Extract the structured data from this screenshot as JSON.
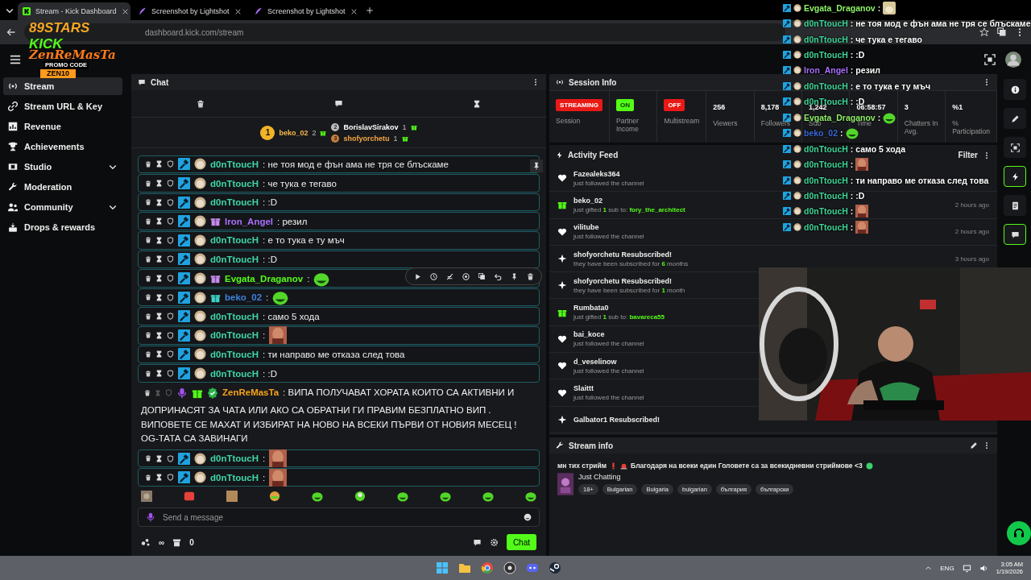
{
  "tabs": [
    {
      "title": "Stream - Kick Dashboard",
      "selected": true
    },
    {
      "title": "Screenshot by Lightshot",
      "selected": false
    },
    {
      "title": "Screenshot by Lightshot",
      "selected": false
    }
  ],
  "address_bar": {
    "url": "dashboard.kick.com/stream"
  },
  "overlay_logo": {
    "brand": "89STARS",
    "kick": "KICK",
    "streamer": "ZenReMasTa",
    "promo": "PROMO CODE",
    "code": "ZEN10"
  },
  "sidebar": {
    "items": [
      {
        "label": "Stream",
        "selected": true,
        "expandable": false
      },
      {
        "label": "Stream URL & Key",
        "selected": false,
        "expandable": false
      },
      {
        "label": "Revenue",
        "selected": false,
        "expandable": false
      },
      {
        "label": "Achievements",
        "selected": false,
        "expandable": false
      },
      {
        "label": "Studio",
        "selected": false,
        "expandable": true
      },
      {
        "label": "Moderation",
        "selected": false,
        "expandable": false
      },
      {
        "label": "Community",
        "selected": false,
        "expandable": true
      },
      {
        "label": "Drops & rewards",
        "selected": false,
        "expandable": false
      }
    ]
  },
  "chat": {
    "title": "Chat",
    "leaderboard": [
      {
        "rank": "1",
        "user": "beko_02",
        "count": "2",
        "color": "#f5b84a"
      },
      {
        "rank": "2",
        "user": "BorislavSirakov",
        "count": "1",
        "color": "#ffffff"
      },
      {
        "rank": "3",
        "user": "shofyorchetu",
        "count": "1",
        "color": "#f5a742"
      }
    ],
    "messages": [
      {
        "kind": "mod",
        "user": "d0nTtoucH",
        "color": "#3fd6a8",
        "text": ": не тоя мод е фън ама не тря се блъскаме",
        "hovered": false
      },
      {
        "kind": "mod",
        "user": "d0nTtoucH",
        "color": "#3fd6a8",
        "text": ": че тука е тегаво",
        "hovered": false
      },
      {
        "kind": "mod",
        "user": "d0nTtoucH",
        "color": "#3fd6a8",
        "text": ": :D",
        "hovered": false
      },
      {
        "kind": "mod",
        "user": "Iron_Angel",
        "color": "#a970ff",
        "gift": {
          "color": "#c88cf0"
        },
        "text": ": резил",
        "hovered": false
      },
      {
        "kind": "mod",
        "user": "d0nTtoucH",
        "color": "#3fd6a8",
        "text": ": е то тука е ту мъч",
        "hovered": false
      },
      {
        "kind": "mod",
        "user": "d0nTtoucH",
        "color": "#3fd6a8",
        "text": ": :D",
        "hovered": false
      },
      {
        "kind": "mod",
        "user": "Evgata_Draganov",
        "color": "#53fc18",
        "gift": {
          "color": "#c88cf0"
        },
        "text": ":",
        "emote": {
          "kind": "frog"
        },
        "hovered": true
      },
      {
        "kind": "mod",
        "user": "beko_02",
        "color": "#3b82e0",
        "gift": {
          "color": "#3fd6c8"
        },
        "text": ":",
        "emote": {
          "kind": "frog"
        },
        "hovered": false
      },
      {
        "kind": "mod",
        "user": "d0nTtoucH",
        "color": "#3fd6a8",
        "text": ": само 5 хода",
        "hovered": false
      },
      {
        "kind": "mod",
        "user": "d0nTtoucH",
        "color": "#3fd6a8",
        "text": ":",
        "emote": {
          "kind": "face"
        },
        "hovered": false
      },
      {
        "kind": "mod",
        "user": "d0nTtoucH",
        "color": "#3fd6a8",
        "text": ": ти направо ме отказа след това",
        "hovered": false
      },
      {
        "kind": "mod",
        "user": "d0nTtoucH",
        "color": "#3fd6a8",
        "text": ": :D",
        "hovered": false
      },
      {
        "kind": "broadcaster",
        "user": "ZenReMasTa",
        "color": "#f7a21b",
        "text": ": ВИПА ПОЛУЧАВАТ ХОРАТА КОИТО СА АКТИВНИ И",
        "text_2": "ДОПРИНАСЯТ ЗА ЧАТА ИЛИ АКО СА ОБРАТНИ ГИ ПРАВИМ БЕЗПЛАТНО ВИП . ВИПОВЕТЕ СЕ МАХАТ И ИЗБИРАТ НА НОВО НА ВСЕКИ ПЪРВИ ОТ НОВИЯ МЕСЕЦ ! OG-ТАТА СА ЗАВИНАГИ",
        "hovered": false
      },
      {
        "kind": "mod",
        "user": "d0nTtoucH",
        "color": "#3fd6a8",
        "text": ":",
        "emote": {
          "kind": "face"
        },
        "hovered": false
      },
      {
        "kind": "mod",
        "user": "d0nTtoucH",
        "color": "#3fd6a8",
        "text": ":",
        "emote": {
          "kind": "face"
        },
        "hovered": false
      }
    ],
    "input": {
      "placeholder": "Send a message"
    },
    "points": "∞",
    "bank": "0",
    "send_button": "Chat"
  },
  "session": {
    "title": "Session Info",
    "stats": [
      {
        "kind": "badge",
        "value": "STREAMING",
        "label": "Session",
        "color": "#e91916"
      },
      {
        "kind": "badge",
        "value": "ON",
        "label": "Partner Income",
        "color": "#53fc18"
      },
      {
        "kind": "badge",
        "value": "OFF",
        "label": "Multistream",
        "color": "#e91916"
      },
      {
        "kind": "number",
        "value": "256",
        "label": "Viewers"
      },
      {
        "kind": "number",
        "value": "8,178",
        "label": "Followers"
      },
      {
        "kind": "number",
        "value": "1,242",
        "label": "Sub"
      },
      {
        "kind": "number",
        "value": "06:58:57",
        "label": "Time"
      },
      {
        "kind": "number",
        "value": "3",
        "label": "Chatters In Avg."
      },
      {
        "kind": "number",
        "value": "%1",
        "label": "% Participation"
      }
    ]
  },
  "activity": {
    "title": "Activity Feed",
    "filter": "Filter",
    "items": [
      {
        "kind": "follow",
        "title": "Fazealeks364",
        "detail": "just followed the channel"
      },
      {
        "kind": "gift",
        "title": "beko_02",
        "detail": "just gifted",
        "count": "1",
        "detail_2": "sub to:",
        "target": "fory_the_architect",
        "time": "2 hours ago"
      },
      {
        "kind": "follow",
        "title": "vilitube",
        "detail": "just followed the channel",
        "time": "2 hours ago"
      },
      {
        "kind": "resub",
        "title": "shofyorchetu Resubscribed!",
        "detail": "they have been subscribed for",
        "count": "6",
        "detail_2": "months",
        "time": "3 hours ago"
      },
      {
        "kind": "resub",
        "title": "shofyorchetu Resubscribed!",
        "detail": "they have been subscribed for",
        "count": "1",
        "detail_2": "month"
      },
      {
        "kind": "gift",
        "title": "Rumbata0",
        "detail": "just gifted",
        "count": "1",
        "detail_2": "sub to:",
        "target": "bavareca55"
      },
      {
        "kind": "follow",
        "title": "bai_koce",
        "detail": "just followed the channel"
      },
      {
        "kind": "follow",
        "title": "d_veselinow",
        "detail": "just followed the channel"
      },
      {
        "kind": "follow",
        "title": "Slaittt",
        "detail": "just followed the channel"
      },
      {
        "kind": "resub",
        "title": "Galbator1 Resubscribed!"
      }
    ]
  },
  "stream_info": {
    "title": "Stream info",
    "stream_title_1": "мн тих стрийм",
    "stream_title_2": "Благодаря на всеки един Головете са за всекидневни стриймове <3",
    "category": "Just Chatting",
    "tags": [
      "18+",
      "Bulgarian",
      "Bulgaria",
      "bulgarian",
      "българия",
      "български"
    ]
  },
  "rail": [
    {
      "selected": false
    },
    {
      "selected": false
    },
    {
      "selected": false
    },
    {
      "selected": true
    },
    {
      "selected": false
    },
    {
      "selected": true
    }
  ],
  "overlay_chat": [
    {
      "user": "Evgata_Draganov",
      "color": "#8ff06a",
      "text": ":",
      "emote": {
        "kind": "dog"
      }
    },
    {
      "user": "d0nTtoucH",
      "color": "#3fd69a",
      "text": ": не тоя мод е фън ама не тря се блъскаме"
    },
    {
      "user": "d0nTtoucH",
      "color": "#3fd69a",
      "text": ": че тука е тегаво"
    },
    {
      "user": "d0nTtoucH",
      "color": "#3fd69a",
      "text": ": :D"
    },
    {
      "user": "Iron_Angel",
      "color": "#a970ff",
      "text": ": резил"
    },
    {
      "user": "d0nTtoucH",
      "color": "#3fd69a",
      "text": ": е то тука е ту мъч"
    },
    {
      "user": "d0nTtoucH",
      "color": "#3fd69a",
      "text": ": :D"
    },
    {
      "user": "Evgata_Draganov",
      "color": "#8ff06a",
      "text": ":",
      "emote": {
        "kind": "frog"
      }
    },
    {
      "user": "beko_02",
      "color": "#3b6ad8",
      "text": ":",
      "emote": {
        "kind": "frog"
      }
    },
    {
      "user": "d0nTtoucH",
      "color": "#3fd69a",
      "text": ": само 5 хода"
    },
    {
      "user": "d0nTtoucH",
      "color": "#3fd69a",
      "text": ":",
      "emote": {
        "kind": "face"
      }
    },
    {
      "user": "d0nTtoucH",
      "color": "#3fd69a",
      "text": ": ти направо ме отказа след това"
    },
    {
      "user": "d0nTtoucH",
      "color": "#3fd69a",
      "text": ": :D"
    },
    {
      "user": "d0nTtoucH",
      "color": "#3fd69a",
      "text": ":",
      "emote": {
        "kind": "face"
      }
    },
    {
      "user": "d0nTtoucH",
      "color": "#3fd69a",
      "text": ":",
      "emote": {
        "kind": "face"
      }
    }
  ],
  "taskbar": {
    "language": "ENG",
    "time": "3:05 AM",
    "date": "1/19/2026"
  }
}
